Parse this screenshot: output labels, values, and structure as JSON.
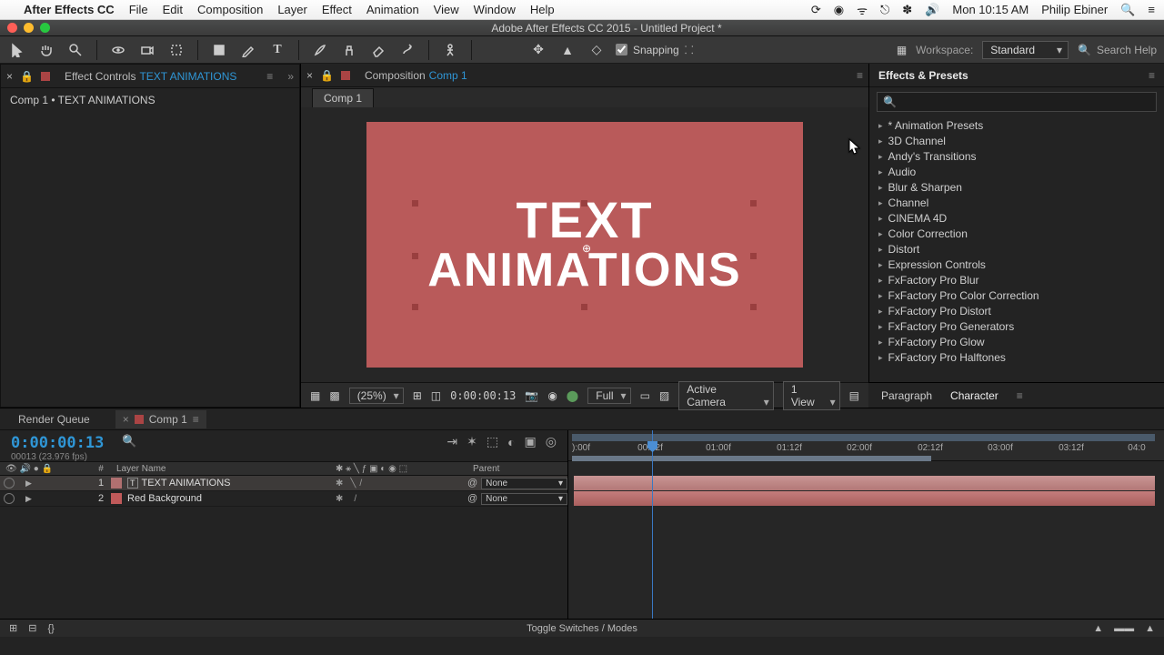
{
  "menubar": {
    "app": "After Effects CC",
    "items": [
      "File",
      "Edit",
      "Composition",
      "Layer",
      "Effect",
      "Animation",
      "View",
      "Window",
      "Help"
    ],
    "clock": "Mon 10:15 AM",
    "user": "Philip Ebiner"
  },
  "window": {
    "title": "Adobe After Effects CC 2015 - Untitled Project *"
  },
  "toolbar": {
    "snapping_label": "Snapping",
    "workspace_label": "Workspace:",
    "workspace_value": "Standard",
    "search_placeholder": "Search Help"
  },
  "effect_controls": {
    "tab_label": "Effect Controls",
    "tab_layer": "TEXT ANIMATIONS",
    "breadcrumb": "Comp 1 • TEXT ANIMATIONS"
  },
  "composition": {
    "panel_label": "Composition",
    "panel_comp": "Comp 1",
    "comp_tab": "Comp 1",
    "text_line1": "TEXT",
    "text_line2": "ANIMATIONS",
    "canvas_color": "#b95a5a",
    "footer": {
      "zoom": "(25%)",
      "timecode": "0:00:00:13",
      "resolution": "Full",
      "camera": "Active Camera",
      "view": "1 View"
    }
  },
  "effects_presets": {
    "title": "Effects & Presets",
    "items": [
      "* Animation Presets",
      "3D Channel",
      "Andy's Transitions",
      "Audio",
      "Blur & Sharpen",
      "Channel",
      "CINEMA 4D",
      "Color Correction",
      "Distort",
      "Expression Controls",
      "FxFactory Pro Blur",
      "FxFactory Pro Color Correction",
      "FxFactory Pro Distort",
      "FxFactory Pro Generators",
      "FxFactory Pro Glow",
      "FxFactory Pro Halftones"
    ]
  },
  "paragraph_tab": "Paragraph",
  "character_tab": "Character",
  "timeline": {
    "tabs": {
      "render_queue": "Render Queue",
      "comp": "Comp 1"
    },
    "timecode": "0:00:00:13",
    "frames_sub": "00013 (23.976 fps)",
    "col_layer": "Layer Name",
    "col_parent": "Parent",
    "none": "None",
    "layers": [
      {
        "num": "1",
        "name": "TEXT ANIMATIONS",
        "swatch": "#b07070",
        "type": "text"
      },
      {
        "num": "2",
        "name": "Red Background",
        "swatch": "#c05a5a",
        "type": "solid"
      }
    ],
    "ruler": [
      "):00f",
      "00:12f",
      "01:00f",
      "01:12f",
      "02:00f",
      "02:12f",
      "03:00f",
      "03:12f",
      "04:0"
    ]
  },
  "status": {
    "toggle": "Toggle Switches / Modes"
  }
}
